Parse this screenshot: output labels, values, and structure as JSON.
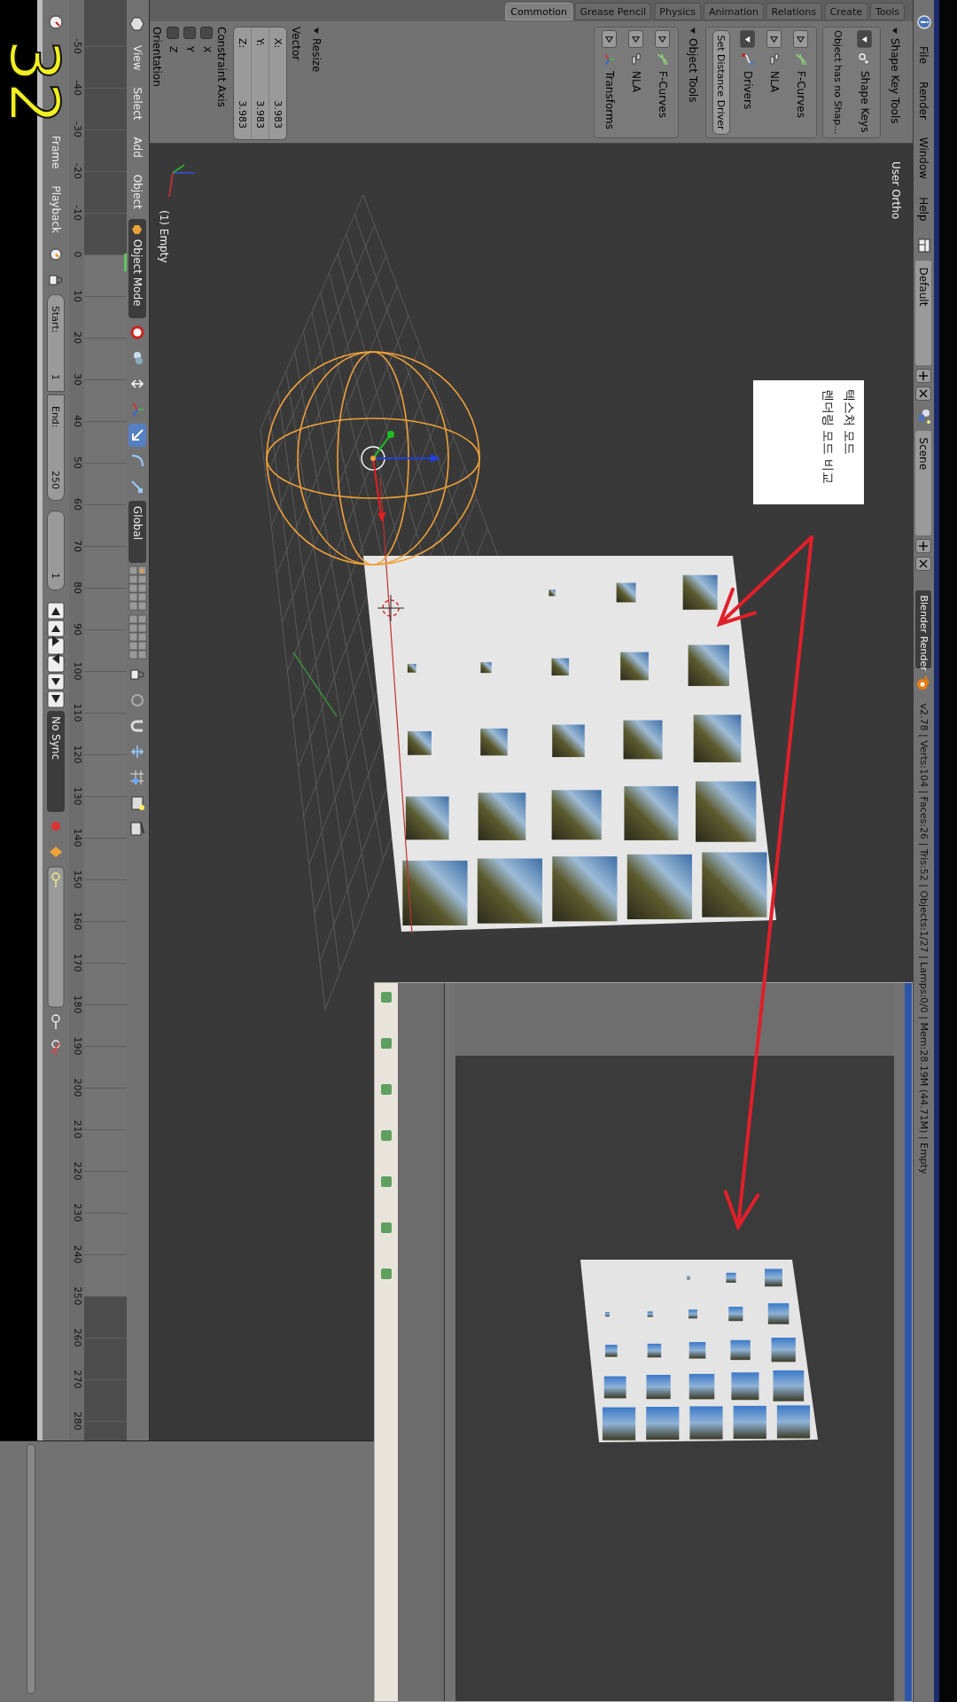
{
  "info_header": {
    "menus": [
      "File",
      "Render",
      "Window",
      "Help"
    ],
    "layout": "Default",
    "scene": "Scene",
    "engine": "Blender Render",
    "stats": "v2.78 | Verts:104 | Faces:26 | Tris:52 | Objects:1/27 | Lamps:0/0 | Mem:28.19M (44.71M) | Empty"
  },
  "tool_shelf": {
    "tabs": [
      {
        "label": "Commotion",
        "selected": true
      },
      {
        "label": "Grease Pencil",
        "selected": false
      },
      {
        "label": "Physics",
        "selected": false
      },
      {
        "label": "Animation",
        "selected": false
      },
      {
        "label": "Relations",
        "selected": false
      },
      {
        "label": "Create",
        "selected": false
      },
      {
        "label": "Tools",
        "selected": false
      }
    ],
    "panels": [
      {
        "title": "Shape Key Tools",
        "expanded": true,
        "boxes": [
          [
            {
              "kind": "toggle",
              "label": "Shape Keys",
              "expanded": true
            },
            {
              "kind": "note",
              "label": "Object has no Shap..."
            }
          ],
          [
            {
              "kind": "toggle",
              "label": "F-Curves",
              "expanded": false
            },
            {
              "kind": "toggle",
              "label": "NLA",
              "expanded": false
            },
            {
              "kind": "toggle",
              "label": "Drivers",
              "expanded": true
            },
            {
              "kind": "button",
              "label": "Set Distance Driver"
            }
          ]
        ]
      },
      {
        "title": "Object Tools",
        "expanded": true,
        "boxes": [
          [
            {
              "kind": "toggle",
              "label": "F-Curves",
              "expanded": false
            },
            {
              "kind": "toggle",
              "label": "NLA",
              "expanded": false
            },
            {
              "kind": "toggle",
              "label": "Transforms",
              "expanded": false
            }
          ]
        ]
      }
    ],
    "resize": {
      "title": "Resize",
      "vector_label": "Vector",
      "vector": [
        {
          "axis": "X:",
          "value": "3.983"
        },
        {
          "axis": "Y:",
          "value": "3.983"
        },
        {
          "axis": "Z:",
          "value": "3.983"
        }
      ],
      "constraint_label": "Constraint Axis",
      "axes": [
        {
          "label": "X",
          "checked": false
        },
        {
          "label": "Y",
          "checked": false
        },
        {
          "label": "Z",
          "checked": false
        }
      ],
      "orientation_label": "Orientation"
    }
  },
  "viewport": {
    "view_name": "User Ortho",
    "object_label": "(1) Empty",
    "note_lines": [
      "텍스처 모드",
      "렌더링 모드 비교"
    ]
  },
  "view3d_header": {
    "menus": [
      "View",
      "Select",
      "Add",
      "Object"
    ],
    "mode": "Object Mode",
    "orientation": "Global"
  },
  "timeline": {
    "ruler_labels": [
      "-50",
      "-40",
      "-30",
      "-20",
      "-10",
      "0",
      "10",
      "20",
      "30",
      "40",
      "50",
      "60",
      "70",
      "80",
      "90",
      "100",
      "110",
      "120",
      "130",
      "140",
      "150",
      "160",
      "170",
      "180",
      "190",
      "200",
      "210",
      "220",
      "230",
      "240",
      "250",
      "260",
      "270",
      "280"
    ],
    "menus": [
      "Frame",
      "Playback"
    ],
    "start_label": "Start:",
    "start": "1",
    "end_label": "End:",
    "end": "250",
    "current": "1",
    "sync": "No Sync"
  },
  "step_number": "32"
}
